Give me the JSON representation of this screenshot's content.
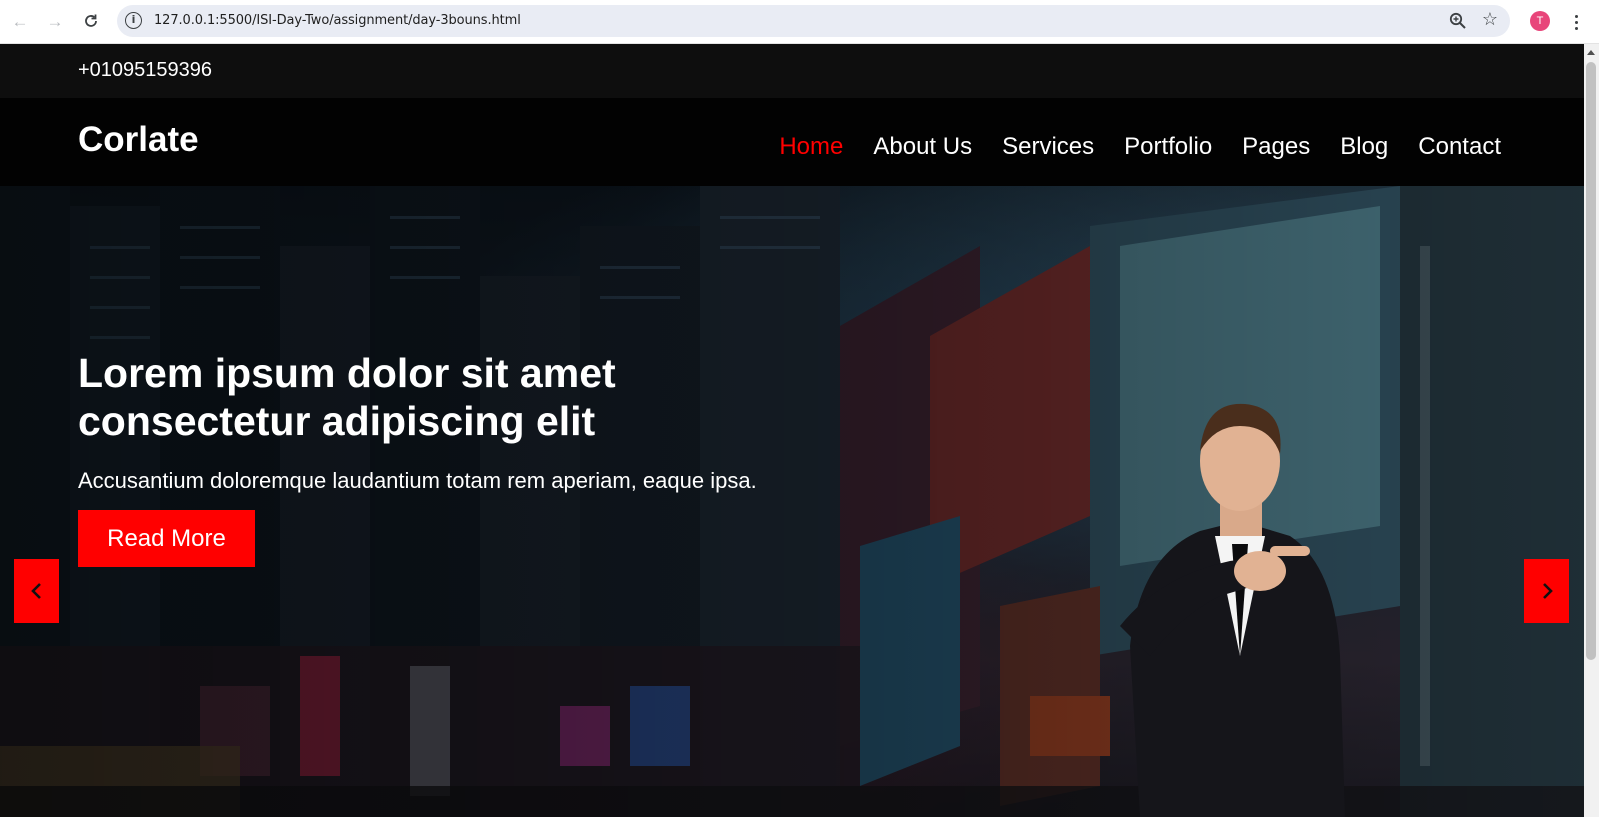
{
  "browser": {
    "url": "127.0.0.1:5500/ISI-Day-Two/assignment/day-3bouns.html",
    "profile_initial": "T"
  },
  "topbar": {
    "phone": "+01095159396"
  },
  "header": {
    "logo": "Corlate",
    "menu": [
      {
        "label": "Home",
        "active": true
      },
      {
        "label": "About Us",
        "active": false
      },
      {
        "label": "Services",
        "active": false
      },
      {
        "label": "Portfolio",
        "active": false
      },
      {
        "label": "Pages",
        "active": false
      },
      {
        "label": "Blog",
        "active": false
      },
      {
        "label": "Contact",
        "active": false
      }
    ]
  },
  "hero": {
    "title_line1": "Lorem ipsum dolor sit amet",
    "title_line2": "consectetur adipiscing elit",
    "subtitle": "Accusantium doloremque laudantium totam rem aperiam, eaque ipsa.",
    "button_label": "Read More"
  },
  "colors": {
    "accent": "#ff0000",
    "topbar_bg": "#0e0e0e",
    "header_bg": "#020202",
    "text": "#ffffff"
  },
  "icons": [
    "back-icon",
    "forward-icon",
    "reload-icon",
    "site-info-icon",
    "zoom-icon",
    "bookmark-star-icon",
    "menu-kebab-icon",
    "chevron-left-icon",
    "chevron-right-icon"
  ]
}
